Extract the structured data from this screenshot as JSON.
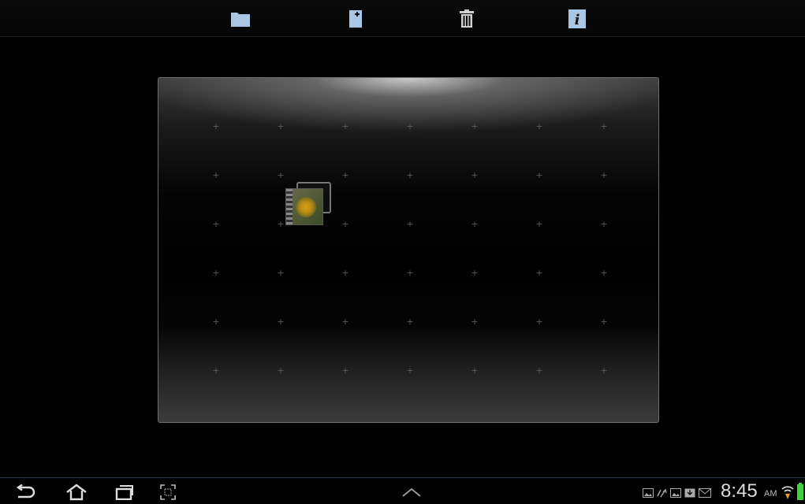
{
  "top_bar": {
    "actions": [
      {
        "id": "folder",
        "icon": "folder-icon"
      },
      {
        "id": "add",
        "icon": "add-page-icon"
      },
      {
        "id": "delete",
        "icon": "trash-icon"
      },
      {
        "id": "info",
        "icon": "info-icon"
      }
    ],
    "icon_color": "#a9c6e4"
  },
  "board": {
    "grid_columns": 7,
    "grid_rows": 6,
    "grid_marker": "+",
    "items": [
      {
        "type": "image-stack",
        "icon": "photo-thumbnail",
        "column": 2,
        "row": 2
      }
    ]
  },
  "nav_bar": {
    "buttons": [
      "back-icon",
      "home-icon",
      "recent-apps-icon",
      "screenshot-icon",
      "chevron-up-icon"
    ],
    "accent": "#173b55"
  },
  "status": {
    "time": "8:45",
    "ampm": "AM",
    "icons": [
      "gallery-icon",
      "sync-icon",
      "gallery-icon",
      "download-icon",
      "mail-icon",
      "wifi-icon",
      "battery-icon"
    ],
    "wifi_color": "#e8a316",
    "battery_color": "#3fd13f"
  }
}
